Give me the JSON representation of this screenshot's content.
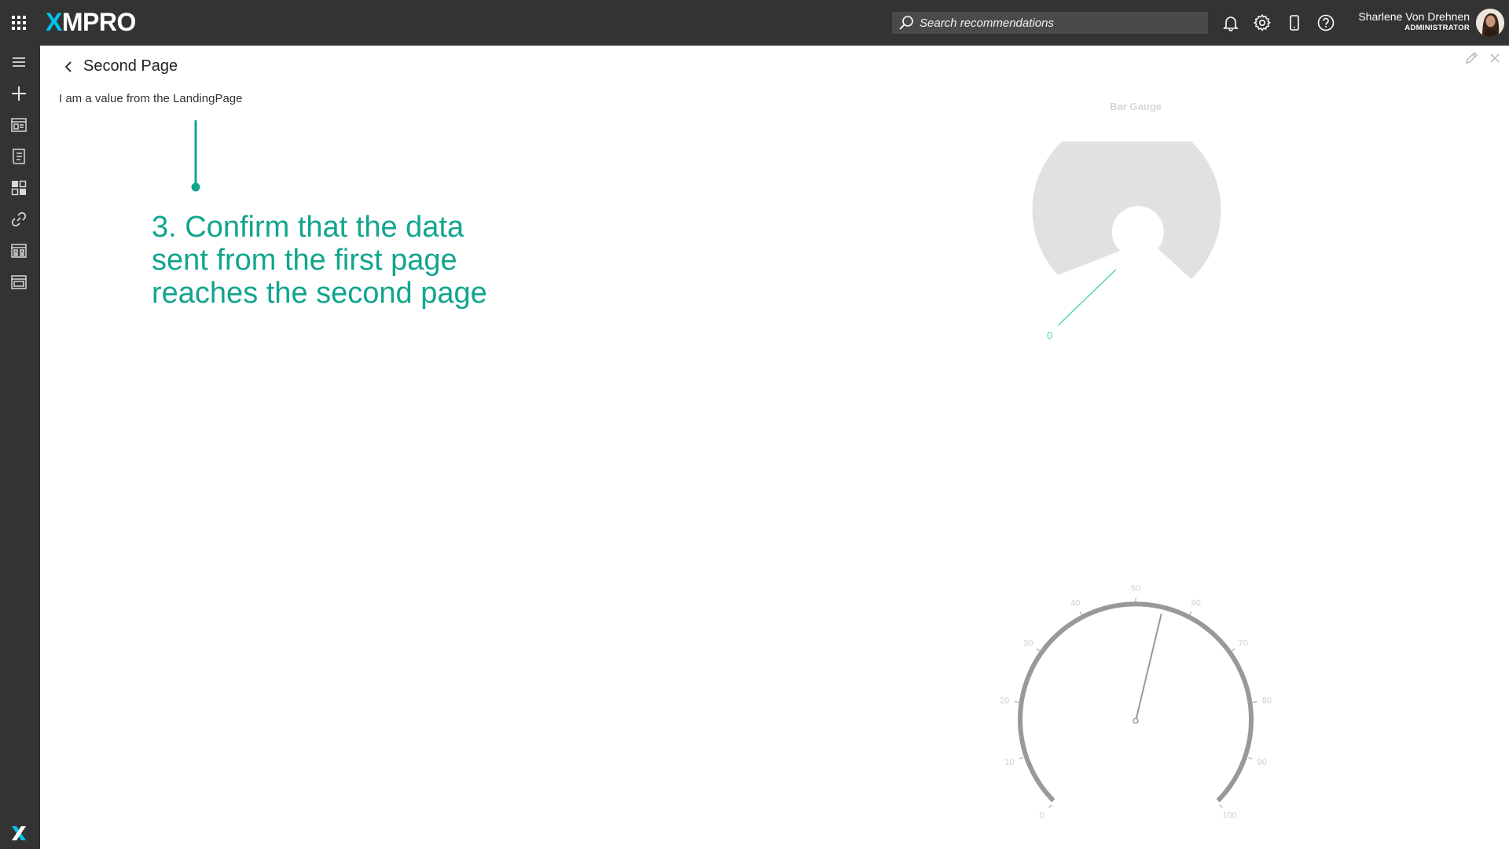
{
  "app": {
    "logo_x": "X",
    "logo_rest": "MPRO"
  },
  "topbar": {
    "search_placeholder": "Search recommendations",
    "user_name": "Sharlene Von Drehnen",
    "user_role": "ADMINISTRATOR",
    "icons": [
      "apps-grid-icon",
      "bell-icon",
      "gear-icon",
      "phone-icon",
      "help-icon"
    ]
  },
  "sidebar": {
    "items": [
      "hamburger-menu-icon",
      "plus-icon",
      "app-designer-icon",
      "recommendations-icon",
      "dashboard-icon",
      "link-icon",
      "blocks-icon",
      "window-icon"
    ]
  },
  "page": {
    "title": "Second Page",
    "value_text": "I am a value from the LandingPage"
  },
  "callout": {
    "text": "3. Confirm that the data sent from the first page reaches the second page",
    "color": "#12a58e"
  },
  "bar_gauge": {
    "title": "Bar Gauge",
    "value": 0,
    "value_label": "0",
    "min": 0,
    "max": 100,
    "track_color": "#e1e1e1",
    "indicator_color": "#4fd1b7"
  },
  "circular_gauge": {
    "min": 0,
    "max": 100,
    "value": 55,
    "ticks": [
      "0",
      "10",
      "20",
      "30",
      "40",
      "50",
      "60",
      "70",
      "80",
      "90",
      "100"
    ],
    "scale_color": "#999999",
    "label_color": "#cfcfcf"
  }
}
